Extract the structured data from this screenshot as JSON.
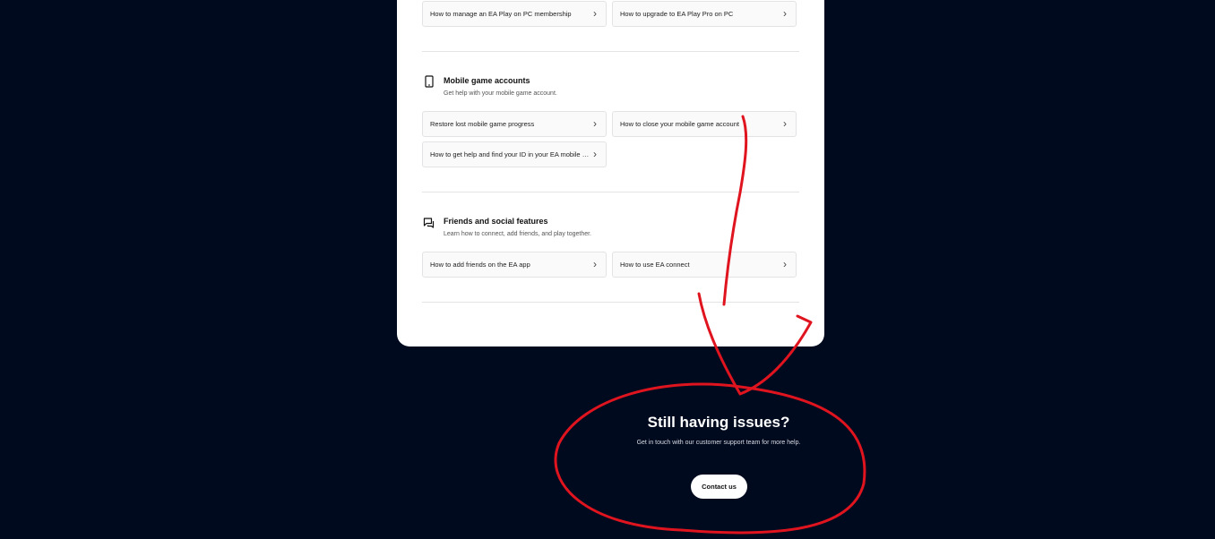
{
  "sections": [
    {
      "id": "ea-play",
      "links": [
        "How to manage an EA Play on PC membership",
        "How to upgrade to EA Play Pro on PC"
      ]
    },
    {
      "id": "mobile",
      "icon": "phone-icon",
      "title": "Mobile game accounts",
      "description": "Get help with your mobile game account.",
      "links": [
        "Restore lost mobile game progress",
        "How to close your mobile game account",
        "How to get help and find your ID in your EA mobile game"
      ]
    },
    {
      "id": "friends",
      "icon": "chat-bubbles-icon",
      "title": "Friends and social features",
      "description": "Learn how to connect, add friends, and play together.",
      "links": [
        "How to add friends on the EA app",
        "How to use EA connect"
      ]
    }
  ],
  "support": {
    "heading": "Still having issues?",
    "text": "Get in touch with our customer support team for more help.",
    "button": "Contact us"
  },
  "colors": {
    "background": "#000a1f",
    "card": "#ffffff",
    "annotation": "#e0141e"
  }
}
